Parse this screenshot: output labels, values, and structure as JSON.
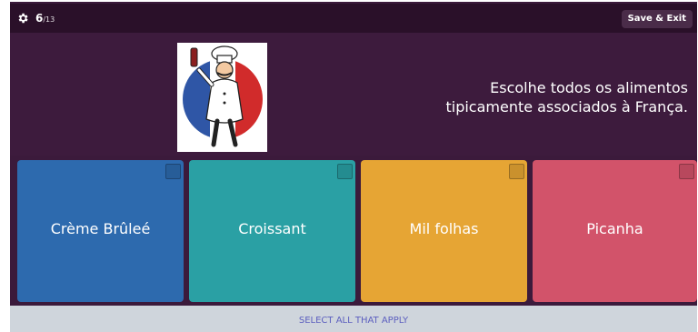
{
  "header": {
    "question_current": "6",
    "question_total": "/13",
    "save_exit_label": "Save & Exit"
  },
  "question": {
    "text": "Escolhe todos os alimentos tipicamente associados à França.",
    "image_icon": "french-chef-icon"
  },
  "options": [
    {
      "label": "Crème Brûleé",
      "color": "#2d6aae"
    },
    {
      "label": "Croissant",
      "color": "#2aa0a4"
    },
    {
      "label": "Mil folhas",
      "color": "#e6a534"
    },
    {
      "label": "Picanha",
      "color": "#d2536a"
    }
  ],
  "footer": {
    "hint": "SELECT ALL THAT APPLY"
  },
  "colors": {
    "background": "#3b1a3b",
    "topbar": "#2a1029",
    "footer": "#cfd5dc",
    "hint_text": "#5c5fbf"
  }
}
